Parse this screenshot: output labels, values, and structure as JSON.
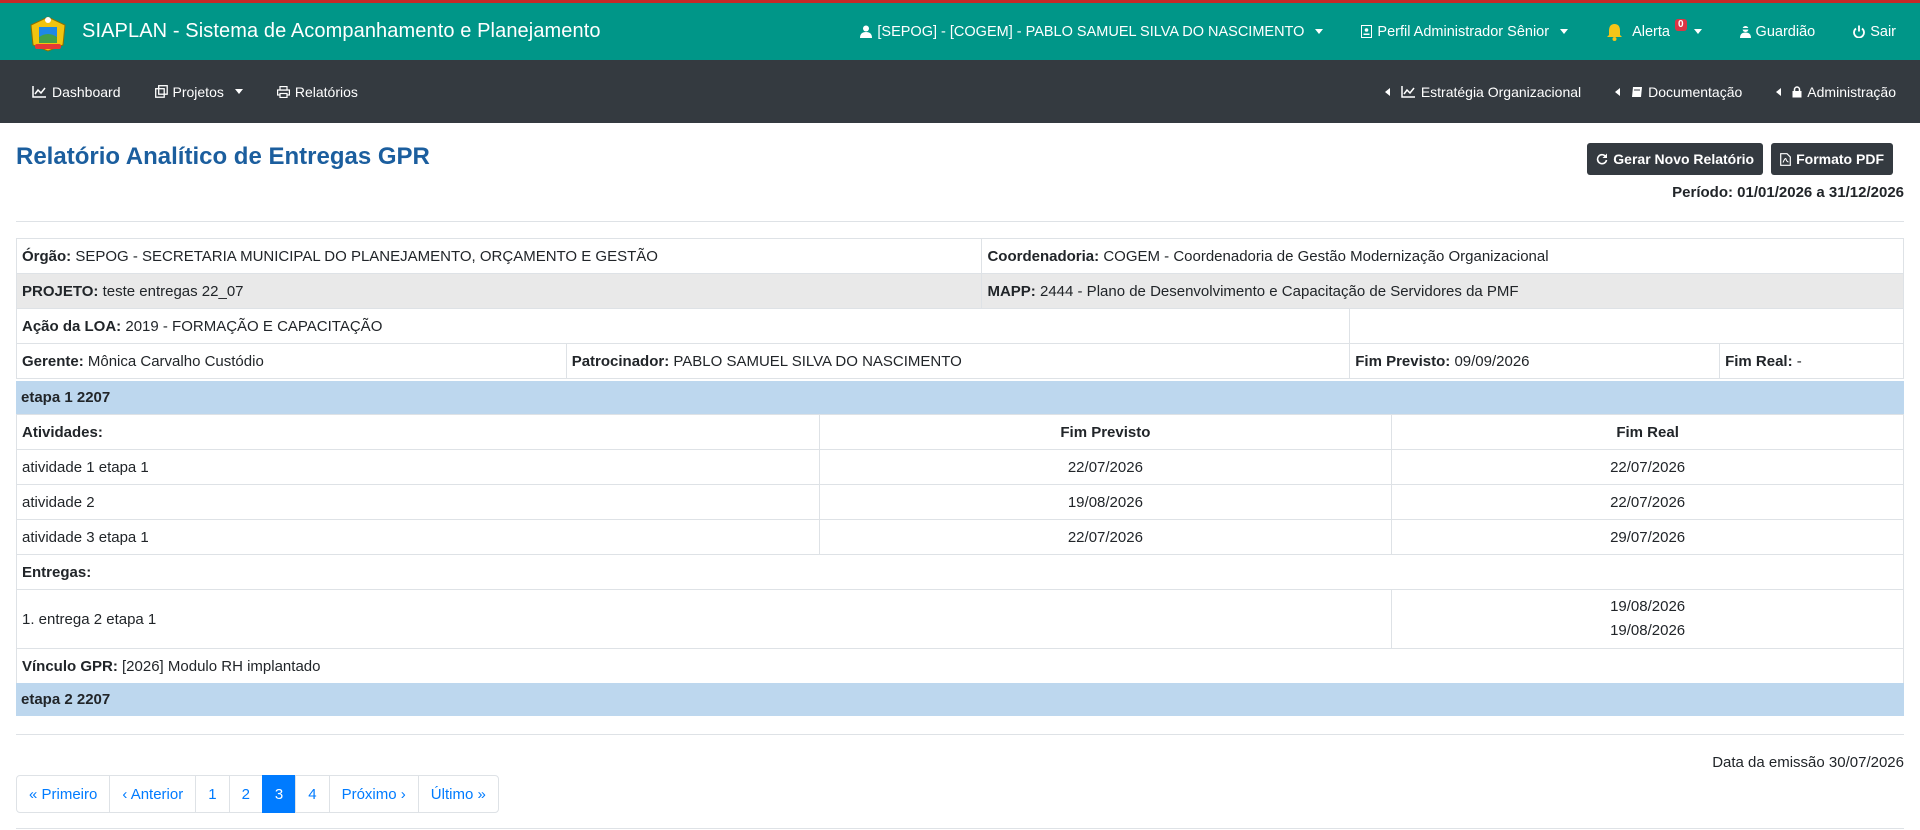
{
  "app": {
    "title": "SIAPLAN - Sistema de Acompanhamento e Planejamento",
    "user_label": "[SEPOG] - [COGEM] - PABLO SAMUEL SILVA DO NASCIMENTO",
    "profile_label": "Perfil Administrador Sênior",
    "alert_label": "Alerta",
    "alert_count": "0",
    "guardian_label": "Guardião",
    "logout_label": "Sair"
  },
  "nav": {
    "left": [
      {
        "label": "Dashboard",
        "icon": "line-chart-icon"
      },
      {
        "label": "Projetos",
        "icon": "clone-icon"
      },
      {
        "label": "Relatórios",
        "icon": "print-icon"
      }
    ],
    "right": [
      {
        "label": "Estratégia Organizacional",
        "icon": "line-chart-icon"
      },
      {
        "label": "Documentação",
        "icon": "book-icon"
      },
      {
        "label": "Administração",
        "icon": "lock-icon"
      }
    ]
  },
  "report": {
    "title": "Relatório Analítico de Entregas GPR",
    "new_report_label": "Gerar Novo Relatório",
    "pdf_label": "Formato PDF",
    "period": "Período: 01/01/2026 a 31/12/2026",
    "info": {
      "orgao_label": "Órgão:",
      "orgao_value": "SEPOG - SECRETARIA MUNICIPAL DO PLANEJAMENTO, ORÇAMENTO E GESTÃO",
      "coord_label": "Coordenadoria:",
      "coord_value": "COGEM - Coordenadoria de Gestão Modernização Organizacional",
      "projeto_label": "PROJETO:",
      "projeto_value": "teste entregas 22_07",
      "mapp_label": "MAPP:",
      "mapp_value": "2444 - Plano de Desenvolvimento e Capacitação de Servidores da PMF",
      "acao_label": "Ação da LOA:",
      "acao_value": "2019 - FORMAÇÃO E CAPACITAÇÃO",
      "gerente_label": "Gerente:",
      "gerente_value": "Mônica Carvalho Custódio",
      "patroc_label": "Patrocinador:",
      "patroc_value": "PABLO SAMUEL SILVA DO NASCIMENTO",
      "fim_prev_label": "Fim Previsto:",
      "fim_prev_value": "09/09/2026",
      "fim_real_label": "Fim Real:",
      "fim_real_value": "-"
    },
    "stage1": {
      "name": "etapa 1 2207",
      "headers": {
        "atividades": "Atividades:",
        "fim_previsto": "Fim Previsto",
        "fim_real": "Fim Real"
      },
      "activities": [
        {
          "name": "atividade 1 etapa 1",
          "prev": "22/07/2026",
          "real": "22/07/2026"
        },
        {
          "name": "atividade 2",
          "prev": "19/08/2026",
          "real": "22/07/2026"
        },
        {
          "name": "atividade 3 etapa 1",
          "prev": "22/07/2026",
          "real": "29/07/2026"
        }
      ],
      "entregas_label": "Entregas:",
      "entrega": {
        "name": "1. entrega 2 etapa 1",
        "date1": "19/08/2026",
        "date2": "19/08/2026"
      },
      "vinculo_label": "Vínculo GPR:",
      "vinculo_value": "[2026] Modulo RH implantado"
    },
    "stage2": {
      "name": "etapa 2 2207"
    },
    "emission": "Data da emissão 30/07/2026"
  },
  "pagination": {
    "first": "« Primeiro",
    "prev": "‹ Anterior",
    "pages": [
      "1",
      "2",
      "3",
      "4"
    ],
    "active": "3",
    "next": "Próximo ›",
    "last": "Último »"
  }
}
